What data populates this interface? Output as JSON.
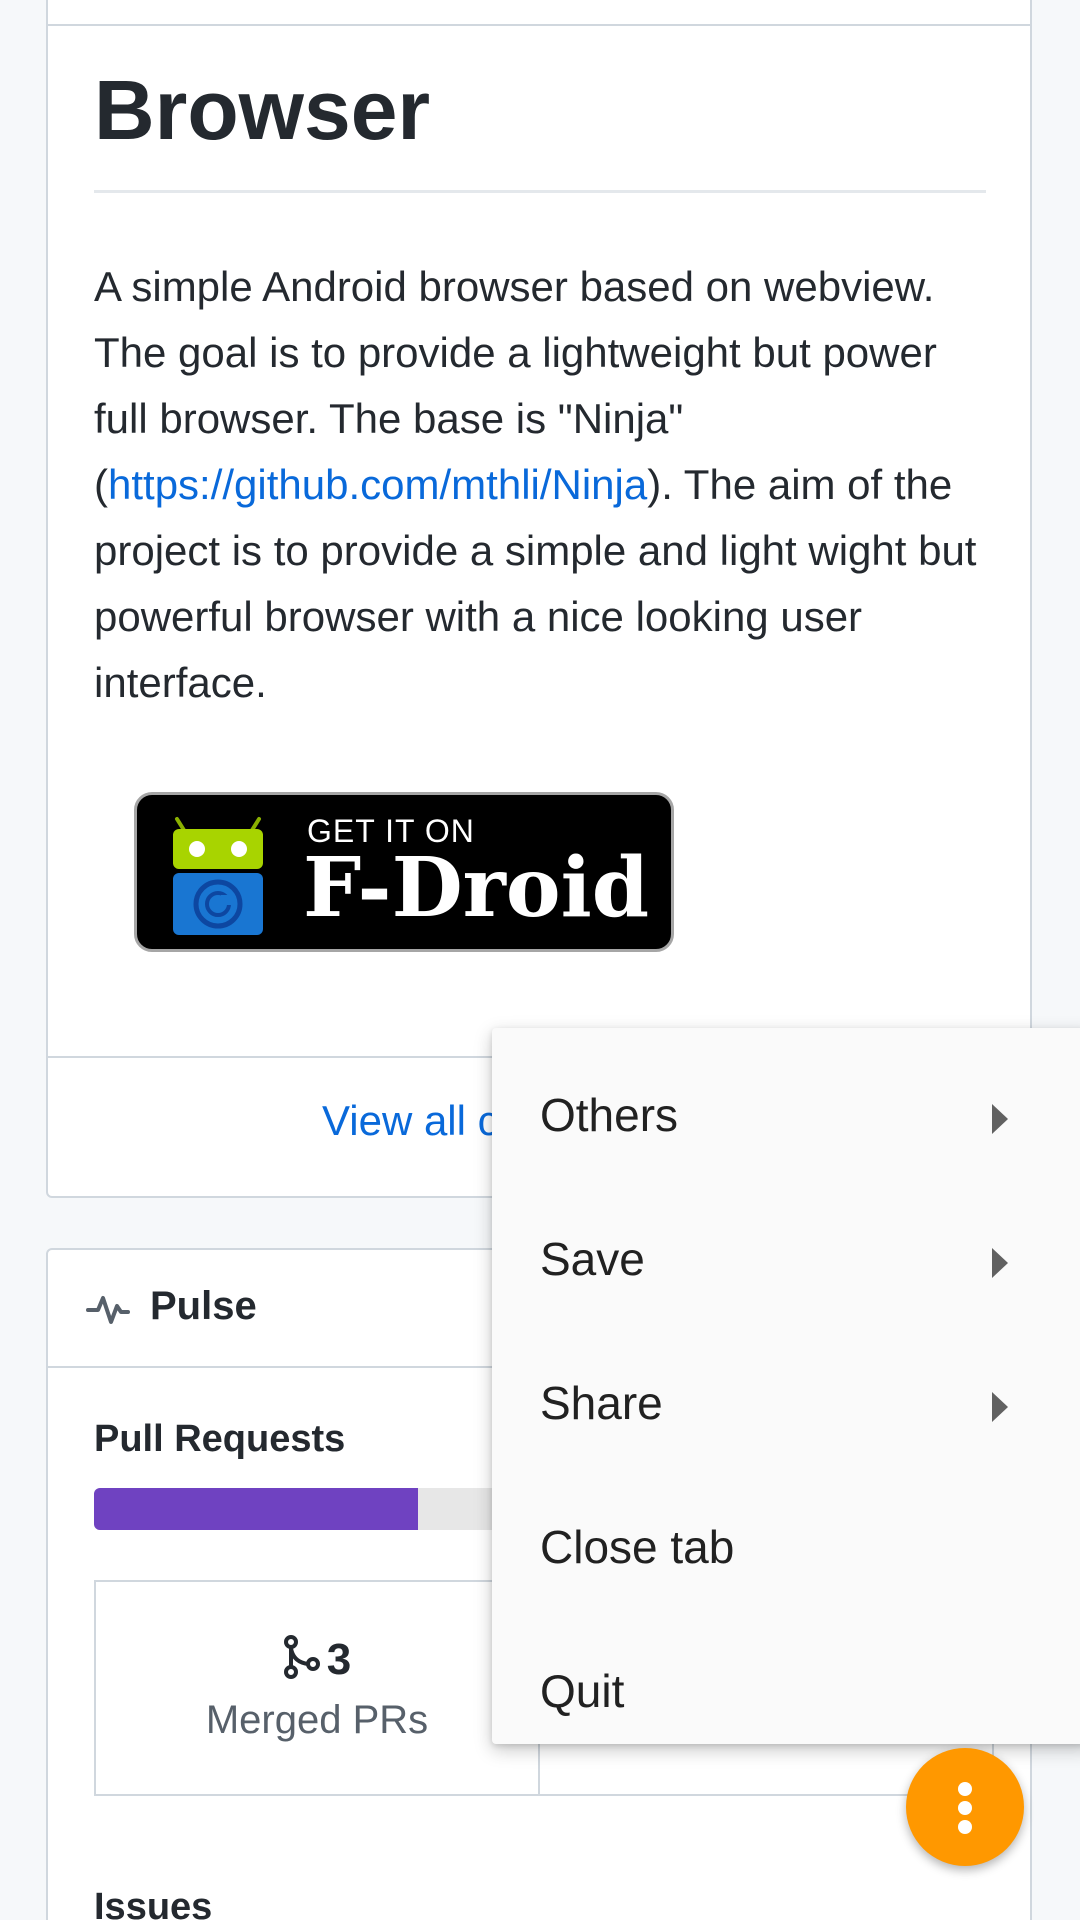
{
  "readme": {
    "title": "Browser",
    "desc_part1": "A simple Android browser based on webview. The goal is to provide a lightweight but power full browser. The base is \"Ninja\" (",
    "link_text": "https://github.com/mthli/Ninja",
    "desc_part2": "). The aim of the project is to provide a simple and light wight but powerful browser with a nice looking user interface.",
    "badge": {
      "get_it_on": "GET IT ON",
      "store_name": "F-Droid"
    },
    "view_all_label": "View all c"
  },
  "pulse": {
    "title": "Pulse",
    "pull_requests_heading": "Pull Requests",
    "pr_bar_fill_percent": 36,
    "merged_count": "3",
    "merged_label": "Merged PRs",
    "issues_heading": "Issues"
  },
  "menu": {
    "items": [
      {
        "label": "Others",
        "has_submenu": true
      },
      {
        "label": "Save",
        "has_submenu": true
      },
      {
        "label": "Share",
        "has_submenu": true
      },
      {
        "label": "Close tab",
        "has_submenu": false
      },
      {
        "label": "Quit",
        "has_submenu": false
      }
    ]
  },
  "colors": {
    "link": "#0969da",
    "fab": "#ff9800",
    "pr_bar": "#6f42c1"
  },
  "icons": {
    "fab": "more-vert-icon",
    "pulse": "pulse-icon",
    "merged": "git-merge-icon",
    "submenu": "arrow-right-icon"
  }
}
